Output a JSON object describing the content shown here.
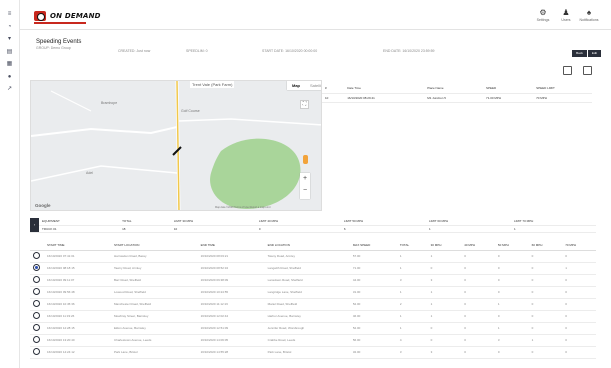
{
  "app": {
    "logo_text": "ON DEMAND",
    "brand_color": "#c8281e",
    "dark_button_color": "#2a2f3a"
  },
  "topbar": {
    "actions": [
      {
        "icon": "gears-icon",
        "label": "Settings"
      },
      {
        "icon": "user-icon",
        "label": "Users"
      },
      {
        "icon": "bell-icon",
        "label": "Notifications"
      }
    ]
  },
  "sidebar": {
    "icons": [
      "menu-icon",
      "gauge-icon",
      "filter-icon",
      "map-icon",
      "report-icon",
      "pin-icon",
      "tool-icon"
    ]
  },
  "card": {
    "title": "Speeding Events",
    "sub": "GROUP: Demo Group",
    "filters": [
      "CREATED: Just now",
      "SPEEDLIM: 0",
      "START DATE: 16/10/2020 00:00:00",
      "END DATE: 16/10/2020 23:59:59"
    ],
    "buttons": [
      "Back",
      "Edit"
    ]
  },
  "map": {
    "location_label": "Trent Vale (Park Farm)",
    "tabs": [
      "Map",
      "Satellite"
    ],
    "google": "Google",
    "footer": "Map data ©2020   Terms of Use   Report a map error",
    "zoom_in": "+",
    "zoom_out": "−",
    "fullscreen": "⛶",
    "place_labels": [
      "Bramhope",
      "Golf Course",
      "Adel"
    ]
  },
  "events": {
    "headers": [
      "#",
      "Date Time",
      "Place Name",
      "SPEED",
      "SPEED LIMIT"
    ],
    "rows": [
      [
        "10",
        "16/10/2020 08:29:41",
        "M1 Junction 5",
        "71.00 MPH",
        "70 MPH"
      ]
    ]
  },
  "summary": {
    "headers": [
      "EQUIPMENT",
      "TOTAL",
      "LIMIT 30 MPH",
      "LIMIT 40 MPH",
      "LIMIT 50 MPH",
      "LIMIT 60 MPH",
      "LIMIT 70 MPH"
    ],
    "rows": [
      [
        "TRUCK 01",
        "18",
        "10",
        "0",
        "6",
        "1",
        "1"
      ]
    ]
  },
  "trips": {
    "headers": [
      "",
      "START TIME",
      "START LOCATION",
      "END TIME",
      "END LOCATION",
      "MAX SPEED",
      "TOTAL",
      "30 MPH",
      "40 MPH",
      "50 MPH",
      "60 MPH",
      "70 MPH"
    ],
    "rows": [
      [
        "16/10/2020 07:41:01",
        "Harrowden Road, Bassy",
        "16/10/2020 08:03:21",
        "Tawny Road, Armley",
        "57.00",
        "1",
        "1",
        "0",
        "0",
        "0",
        "0"
      ],
      [
        "16/10/2020 08:18:15",
        "Tawny Road, Armley",
        "16/10/2020 08:52:34",
        "Langwith Road, Sheffield",
        "71.00",
        "1",
        "0",
        "0",
        "0",
        "0",
        "1"
      ],
      [
        "16/10/2020 09:11:07",
        "Barr Road, Sheffield",
        "16/10/2020 09:38:09",
        "Lansdown Road, Sheffield",
        "44.00",
        "3",
        "3",
        "0",
        "0",
        "0",
        "0"
      ],
      [
        "16/10/2020 09:56:48",
        "Lowood Road, Sheffield",
        "16/10/2020 10:24:55",
        "Langridge Lane, Sheffield",
        "31.00",
        "1",
        "1",
        "0",
        "0",
        "0",
        "0"
      ],
      [
        "16/10/2020 10:45:36",
        "Manchester Road, Sheffield",
        "16/10/2020 11:12:16",
        "Mariel Road, Sheffield",
        "52.00",
        "2",
        "1",
        "0",
        "1",
        "0",
        "0"
      ],
      [
        "16/10/2020 11:33:26",
        "Mowbray Street, Barnsley",
        "16/10/2020 12:02:44",
        "Harbor Avenue, Barnsley",
        "46.00",
        "1",
        "1",
        "0",
        "0",
        "0",
        "0"
      ],
      [
        "16/10/2020 12:28:15",
        "Eldon Avenue, Barnsley",
        "16/10/2020 12:51:09",
        "Jennifer Road, Worsbrough",
        "52.00",
        "1",
        "0",
        "0",
        "1",
        "0",
        "0"
      ],
      [
        "16/10/2020 13:20:40",
        "Charlestown Avenue, Leeds",
        "16/10/2020 14:06:05",
        "Crabbe Road, Leeds",
        "56.00",
        "4",
        "0",
        "0",
        "3",
        "1",
        "0"
      ],
      [
        "16/10/2020 14:24:12",
        "Park Lane, Bristol",
        "16/10/2020 14:55:28",
        "Park Lane, Bristol",
        "32.00",
        "3",
        "3",
        "0",
        "0",
        "0",
        "0"
      ]
    ]
  }
}
